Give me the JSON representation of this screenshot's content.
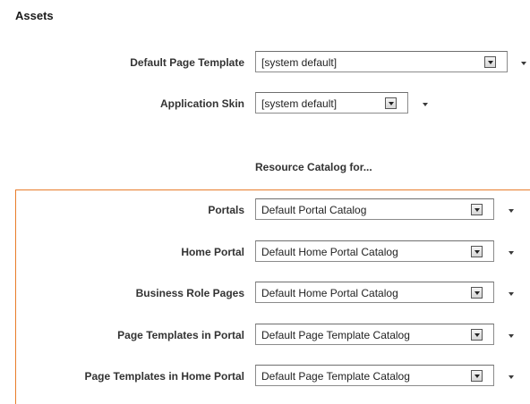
{
  "section": {
    "title": "Assets"
  },
  "page_template": {
    "label": "Default Page Template",
    "value": "[system default]"
  },
  "application_skin": {
    "label": "Application Skin",
    "value": "[system default]"
  },
  "resource_catalog": {
    "heading": "Resource Catalog for...",
    "rows": [
      {
        "label": "Portals",
        "value": "Default Portal Catalog"
      },
      {
        "label": "Home Portal",
        "value": "Default Home Portal Catalog"
      },
      {
        "label": "Business Role Pages",
        "value": "Default Home Portal Catalog"
      },
      {
        "label": "Page Templates in Portal",
        "value": "Default Page Template Catalog"
      },
      {
        "label": "Page Templates in Home Portal",
        "value": "Default Page Template Catalog"
      }
    ]
  },
  "colors": {
    "accent_border": "#e87d2b"
  },
  "icons": {
    "dropdown": "dropdown-arrow-icon",
    "menu": "caret-down-icon"
  }
}
